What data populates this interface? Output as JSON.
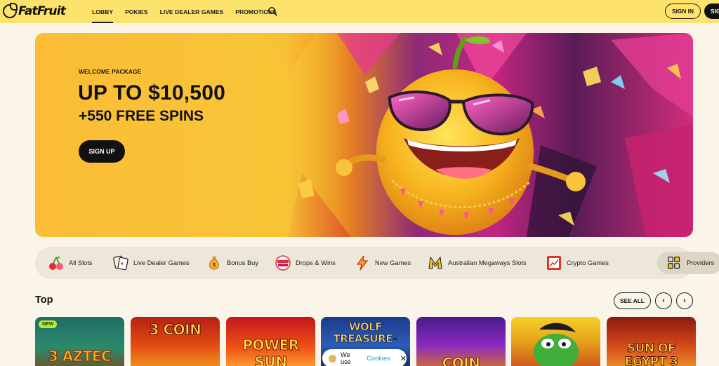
{
  "brand": {
    "name": "FatFruit"
  },
  "nav": {
    "items": [
      {
        "label": "LOBBY",
        "active": true
      },
      {
        "label": "POKIES",
        "active": false
      },
      {
        "label": "LIVE DEALER GAMES",
        "active": false
      },
      {
        "label": "PROMOTIONS",
        "active": false
      }
    ],
    "search_icon": "search-icon"
  },
  "auth": {
    "sign_in": "SIGN IN",
    "sign_up": "SIG"
  },
  "hero": {
    "kicker": "WELCOME PACKAGE",
    "title": "UP TO $10,500",
    "subtitle": "+550 FREE SPINS",
    "cta": "SIGN UP"
  },
  "categories": [
    {
      "label": "All Slots",
      "icon": "cherries-icon"
    },
    {
      "label": "Live Dealer Games",
      "icon": "cards-icon"
    },
    {
      "label": "Bonus Buy",
      "icon": "money-bag-icon"
    },
    {
      "label": "Drops & Wins",
      "icon": "drops-wins-icon"
    },
    {
      "label": "New Games",
      "icon": "lightning-icon"
    },
    {
      "label": "Australian Megaways Slots",
      "icon": "megaways-icon"
    },
    {
      "label": "Crypto Games",
      "icon": "crypto-icon"
    }
  ],
  "providers": {
    "label": "Providers",
    "icon": "grid-icon"
  },
  "top": {
    "title": "Top",
    "see_all": "SEE ALL",
    "prev": "‹",
    "next": "›",
    "games": [
      {
        "title": "3 AZTEC",
        "badge": "NEW"
      },
      {
        "title": "3 COIN"
      },
      {
        "title": "POWER SUN"
      },
      {
        "title": "WOLF TREASURE",
        "mark": "™"
      },
      {
        "title": "COIN"
      },
      {
        "title": ""
      },
      {
        "title": "SUN OF EGYPT 3"
      }
    ]
  },
  "cookie": {
    "text": "We use",
    "link": "Cookies",
    "close": "✕"
  },
  "colors": {
    "header": "#fde36b",
    "page": "#faf5e8",
    "accent": "#111111",
    "new_badge": "#b8ea3b"
  }
}
